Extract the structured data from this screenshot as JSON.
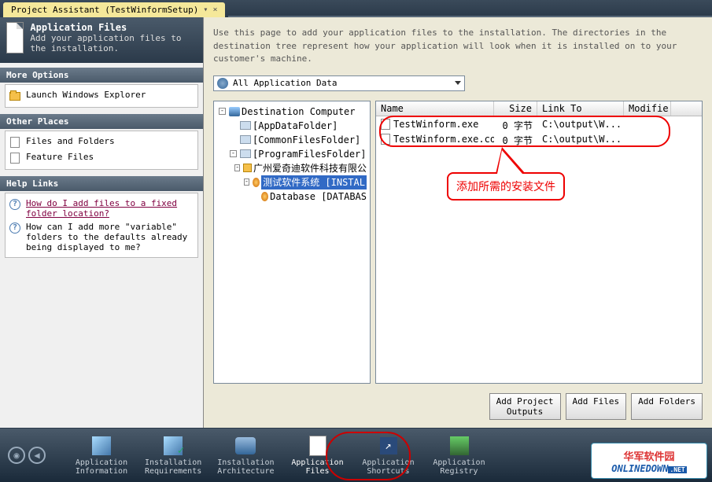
{
  "tab": {
    "title": "Project Assistant (TestWinformSetup)"
  },
  "header": {
    "title": "Application Files",
    "subtitle": "Add your application files to the installation."
  },
  "more_options": {
    "head": "More Options",
    "items": [
      "Launch Windows Explorer"
    ]
  },
  "other_places": {
    "head": "Other Places",
    "items": [
      "Files and Folders",
      "Feature Files"
    ]
  },
  "help_links": {
    "head": "Help Links",
    "items": [
      {
        "text": "How do I add files to a fixed folder location?",
        "link": true
      },
      {
        "text": "How can I add more \"variable\" folders to the defaults already being displayed to me?",
        "link": false
      }
    ]
  },
  "description": "Use this page to add your application files to the installation. The directories in the destination tree represent how your application will look when it is installed on to your customer's machine.",
  "dropdown": {
    "value": "All Application Data"
  },
  "tree": [
    {
      "indent": 0,
      "exp": "-",
      "icon": "comp",
      "label": "Destination Computer"
    },
    {
      "indent": 1,
      "exp": "",
      "icon": "fld",
      "label": "[AppDataFolder]"
    },
    {
      "indent": 1,
      "exp": "",
      "icon": "fld",
      "label": "[CommonFilesFolder]"
    },
    {
      "indent": 1,
      "exp": "-",
      "icon": "fld",
      "label": "[ProgramFilesFolder]"
    },
    {
      "indent": 2,
      "exp": "-",
      "icon": "fld open",
      "label": "广州爱奇迪软件科技有限公"
    },
    {
      "indent": 3,
      "exp": "-",
      "icon": "db",
      "label": "测试软件系统 [INSTAL",
      "sel": true
    },
    {
      "indent": 4,
      "exp": "",
      "icon": "db",
      "label": "Database [DATABAS"
    }
  ],
  "file_columns": {
    "name": "Name",
    "size": "Size",
    "link": "Link To",
    "mod": "Modifie"
  },
  "files": [
    {
      "name": "TestWinform.exe",
      "size": "0 字节",
      "link": "C:\\output\\W..."
    },
    {
      "name": "TestWinform.exe.co...",
      "size": "0 字节",
      "link": "C:\\output\\W..."
    }
  ],
  "callout_text": "添加所需的安装文件",
  "buttons": {
    "add_outputs": "Add Project\nOutputs",
    "add_files": "Add Files",
    "add_folders": "Add Folders"
  },
  "nav": [
    {
      "icon": "pkg",
      "label": "Application\nInformation"
    },
    {
      "icon": "chk",
      "label": "Installation\nRequirements"
    },
    {
      "icon": "arch",
      "label": "Installation\nArchitecture"
    },
    {
      "icon": "box",
      "label": "Application\nFiles",
      "sel": true
    },
    {
      "icon": "short",
      "label": "Application\nShortcuts"
    },
    {
      "icon": "reg",
      "label": "Application\nRegistry"
    }
  ],
  "watermark": {
    "cn": "华军软件园",
    "en": "ONLINEDOWN",
    "net": ".NET"
  }
}
